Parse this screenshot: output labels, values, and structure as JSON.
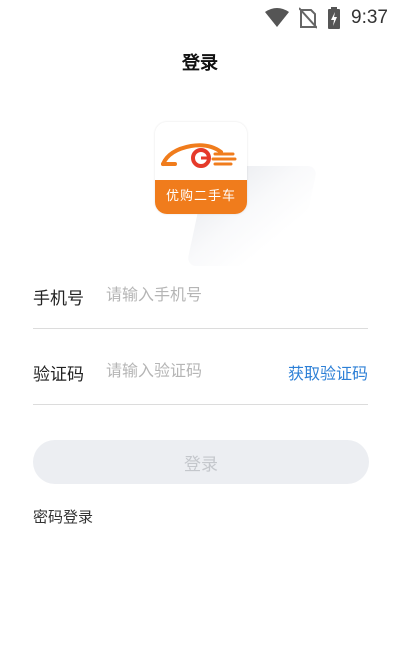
{
  "status_bar": {
    "time": "9:37",
    "icons": [
      "wifi-icon",
      "no-sim-icon",
      "battery-charging-icon"
    ]
  },
  "header": {
    "title": "登录"
  },
  "logo": {
    "brand_text": "优购二手车",
    "accent_color": "#f07c1c"
  },
  "form": {
    "phone": {
      "label": "手机号",
      "placeholder": "请输入手机号",
      "value": ""
    },
    "code": {
      "label": "验证码",
      "placeholder": "请输入验证码",
      "value": "",
      "get_code_label": "获取验证码"
    }
  },
  "login_button": {
    "label": "登录"
  },
  "password_login": {
    "label": "密码登录"
  },
  "colors": {
    "link": "#2c7fd6",
    "button_disabled_bg": "#eceef2",
    "button_disabled_text": "#c4c7cc"
  }
}
